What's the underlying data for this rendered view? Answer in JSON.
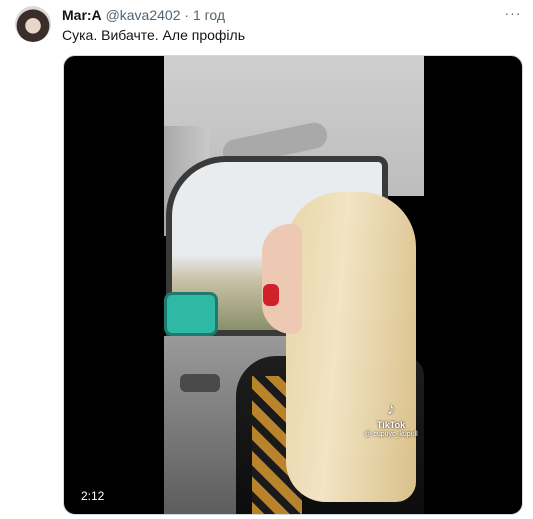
{
  "tweet": {
    "author_name": "Mar:A",
    "handle": "@kava2402",
    "separator": "·",
    "time": "1 год",
    "more_label": "···",
    "text": "Сука. Вибачте. Але профіль"
  },
  "video": {
    "duration": "2:12",
    "watermark_logo": "♪",
    "watermark_brand": "TikTok",
    "watermark_user": "@ cupuyc_kupull"
  }
}
